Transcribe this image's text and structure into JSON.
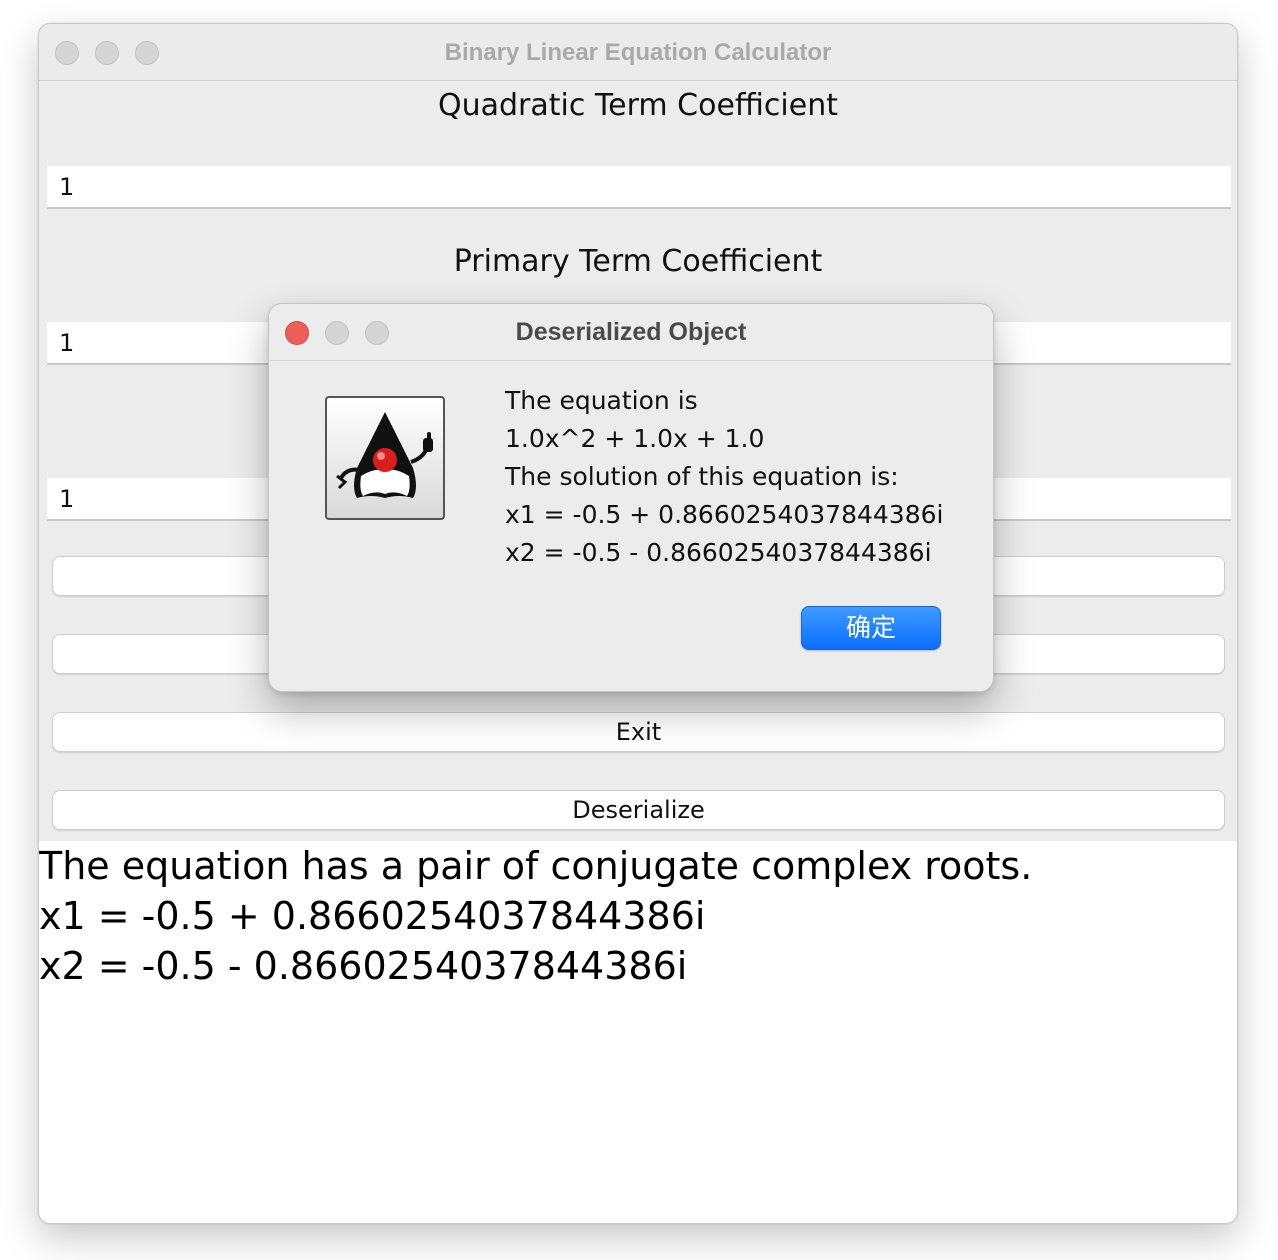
{
  "window": {
    "title": "Binary Linear Equation Calculator"
  },
  "form": {
    "quadratic_label": "Quadratic Term Coefficient",
    "quadratic_value": "1",
    "primary_label": "Primary Term Coefficient",
    "primary_value": "1",
    "constant_value": "1"
  },
  "buttons": {
    "exit_label": "Exit",
    "deserialize_label": "Deserialize"
  },
  "output": {
    "lines": [
      "The equation has a pair of conjugate complex roots.",
      "x1 = -0.5 + 0.8660254037844386i",
      "x2 = -0.5 - 0.8660254037844386i"
    ]
  },
  "dialog": {
    "title": "Deserialized Object",
    "icon": "java-duke-icon",
    "message_lines": [
      "The equation is",
      "1.0x^2 + 1.0x + 1.0",
      "The solution of this equation is:",
      "x1 = -0.5 + 0.8660254037844386i",
      "x2 = -0.5 - 0.8660254037844386i"
    ],
    "ok_label": "确定"
  },
  "colors": {
    "close_button": "#ec5f58",
    "ok_button": "#0a6fff",
    "window_bg": "#ececec"
  }
}
